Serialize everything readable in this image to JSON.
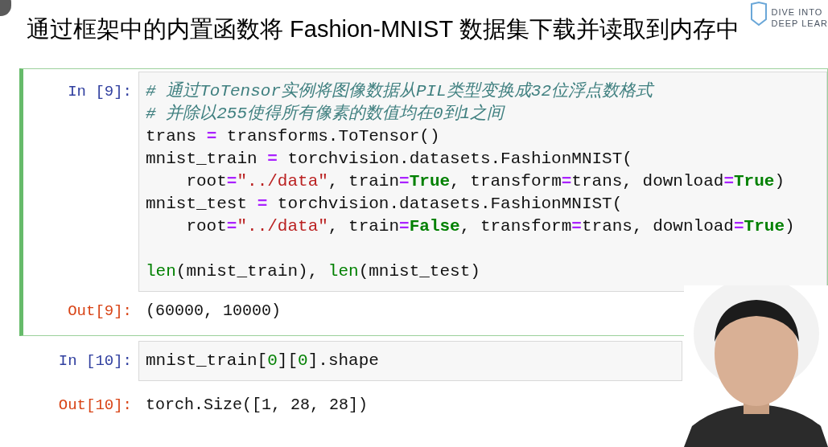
{
  "title": "通过框架中的内置函数将 Fashion-MNIST 数据集下载并读取到内存中",
  "logo": {
    "lines": [
      "DIVE INTO",
      "DEEP LEAR"
    ]
  },
  "cells": [
    {
      "selected": true,
      "in_prompt": "In [9]:",
      "out_prompt": "Out[9]:",
      "output": "(60000, 10000)",
      "code": [
        [
          {
            "kind": "comment",
            "text": "# 通过ToTensor实例将图像数据从PIL类型变换成32位浮点数格式"
          }
        ],
        [
          {
            "kind": "comment",
            "text": "# 并除以255使得所有像素的数值均在0到1之间"
          }
        ],
        [
          {
            "kind": "plain",
            "text": "trans "
          },
          {
            "kind": "op",
            "text": "="
          },
          {
            "kind": "plain",
            "text": " transforms.ToTensor()"
          }
        ],
        [
          {
            "kind": "plain",
            "text": "mnist_train "
          },
          {
            "kind": "op",
            "text": "="
          },
          {
            "kind": "plain",
            "text": " torchvision.datasets.FashionMNIST("
          }
        ],
        [
          {
            "kind": "plain",
            "text": "    root"
          },
          {
            "kind": "op",
            "text": "="
          },
          {
            "kind": "string",
            "text": "\"../data\""
          },
          {
            "kind": "plain",
            "text": ", train"
          },
          {
            "kind": "op",
            "text": "="
          },
          {
            "kind": "keyword",
            "text": "True"
          },
          {
            "kind": "plain",
            "text": ", transform"
          },
          {
            "kind": "op",
            "text": "="
          },
          {
            "kind": "plain",
            "text": "trans, download"
          },
          {
            "kind": "op",
            "text": "="
          },
          {
            "kind": "keyword",
            "text": "True"
          },
          {
            "kind": "plain",
            "text": ")"
          }
        ],
        [
          {
            "kind": "plain",
            "text": "mnist_test "
          },
          {
            "kind": "op",
            "text": "="
          },
          {
            "kind": "plain",
            "text": " torchvision.datasets.FashionMNIST("
          }
        ],
        [
          {
            "kind": "plain",
            "text": "    root"
          },
          {
            "kind": "op",
            "text": "="
          },
          {
            "kind": "string",
            "text": "\"../data\""
          },
          {
            "kind": "plain",
            "text": ", train"
          },
          {
            "kind": "op",
            "text": "="
          },
          {
            "kind": "keyword",
            "text": "False"
          },
          {
            "kind": "plain",
            "text": ", transform"
          },
          {
            "kind": "op",
            "text": "="
          },
          {
            "kind": "plain",
            "text": "trans, download"
          },
          {
            "kind": "op",
            "text": "="
          },
          {
            "kind": "keyword",
            "text": "True"
          },
          {
            "kind": "plain",
            "text": ")"
          }
        ],
        [
          {
            "kind": "gap"
          },
          {
            "kind": "builtin",
            "text": "len"
          },
          {
            "kind": "plain",
            "text": "(mnist_train), "
          },
          {
            "kind": "builtin",
            "text": "len"
          },
          {
            "kind": "plain",
            "text": "(mnist_test)"
          }
        ]
      ]
    },
    {
      "selected": false,
      "in_prompt": "In [10]:",
      "out_prompt": "Out[10]:",
      "output": "torch.Size([1, 28, 28])",
      "code": [
        [
          {
            "kind": "plain",
            "text": "mnist_train["
          },
          {
            "kind": "number",
            "text": "0"
          },
          {
            "kind": "plain",
            "text": "]["
          },
          {
            "kind": "number",
            "text": "0"
          },
          {
            "kind": "plain",
            "text": "].shape"
          }
        ]
      ]
    }
  ]
}
